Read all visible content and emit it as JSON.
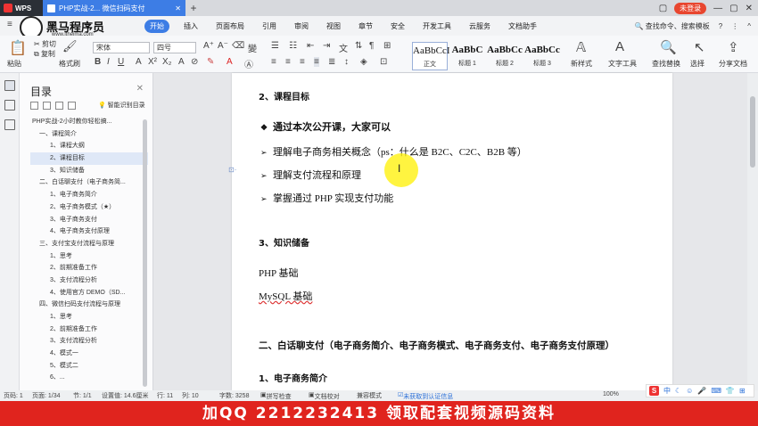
{
  "titlebar": {
    "app_tab": "WPS",
    "doc_tab": "PHP实战-2... 微信扫码支付",
    "login_label": "未登录"
  },
  "logo": {
    "name": "黑马程序员",
    "url": "www.itheima.com"
  },
  "menu": {
    "items": [
      "开始",
      "插入",
      "页面布局",
      "引用",
      "审阅",
      "视图",
      "章节",
      "安全",
      "开发工具",
      "云服务",
      "文档助手"
    ],
    "active": "开始",
    "search_label": "查找命令、搜索模板"
  },
  "ribbon": {
    "paste": "粘贴",
    "cut": "剪切",
    "copy": "复制",
    "format_painter": "格式刷",
    "font_name": "宋体",
    "font_size": "四号",
    "styles": [
      {
        "preview": "AaBbCcI",
        "label": "正文"
      },
      {
        "preview": "AaBbC",
        "label": "标题 1"
      },
      {
        "preview": "AaBbCc",
        "label": "标题 2"
      },
      {
        "preview": "AaBbCc",
        "label": "标题 3"
      }
    ],
    "new_style": "新样式",
    "text_tools": "文字工具",
    "find_replace": "查找替换",
    "select": "选择",
    "share": "分享文档"
  },
  "toc": {
    "title": "目录",
    "smart_label": "智能识别目录",
    "items": [
      {
        "text": "PHP实战-2小时教你轻松搞...",
        "level": 1
      },
      {
        "text": "一、课程简介",
        "level": 0
      },
      {
        "text": "1、课程大纲",
        "level": 2
      },
      {
        "text": "2、课程目标",
        "level": 2,
        "selected": true
      },
      {
        "text": "3、知识储备",
        "level": 2
      },
      {
        "text": "二、白话聊支付（电子商务简...",
        "level": 0
      },
      {
        "text": "1、电子商务简介",
        "level": 2
      },
      {
        "text": "2、电子商务模式（★）",
        "level": 2
      },
      {
        "text": "3、电子商务支付",
        "level": 2
      },
      {
        "text": "4、电子商务支付原理",
        "level": 2
      },
      {
        "text": "三、支付宝支付流程与原理",
        "level": 0
      },
      {
        "text": "1、思考",
        "level": 2
      },
      {
        "text": "2、前期准备工作",
        "level": 2
      },
      {
        "text": "3、支付流程分析",
        "level": 2
      },
      {
        "text": "4、使用官方 DEMO（SD...",
        "level": 2
      },
      {
        "text": "四、微信扫码支付流程与原理",
        "level": 0
      },
      {
        "text": "1、思考",
        "level": 2
      },
      {
        "text": "2、前期准备工作",
        "level": 2
      },
      {
        "text": "3、支付流程分析",
        "level": 2
      },
      {
        "text": "4、模式一",
        "level": 2
      },
      {
        "text": "5、模式二",
        "level": 2
      },
      {
        "text": "6、...",
        "level": 2
      }
    ]
  },
  "document": {
    "h_goal": "2、课程目标",
    "intro": "通过本次公开课，大家可以",
    "bullets": [
      "理解电子商务相关概念（ps：什么是 B2C、C2C、B2B 等）",
      "理解支付流程和原理",
      "掌握通过 PHP 实现支付功能"
    ],
    "h_knowledge": "3、知识储备",
    "k1": "PHP 基础",
    "k2": "MySQL 基础",
    "h_section2": "二、白话聊支付（电子商务简介、电子商务模式、电子商务支付、电子商务支付原理）",
    "h_sub1": "1、电子商务简介"
  },
  "statusbar": {
    "page_num": "页码: 1",
    "pages": "页面: 1/34",
    "section": "节: 1/1",
    "position": "设置值: 14.6厘米",
    "row": "行: 11",
    "col": "列: 10",
    "words": "字数: 3258",
    "spell": "拼写检查",
    "proof": "文档校对",
    "compat": "兼容模式",
    "cert": "未获取到认证信息",
    "zoom": "100%"
  },
  "ime": {
    "lang": "中"
  },
  "banner": {
    "text": "加QQ 2212232413 领取配套视频源码资料"
  }
}
